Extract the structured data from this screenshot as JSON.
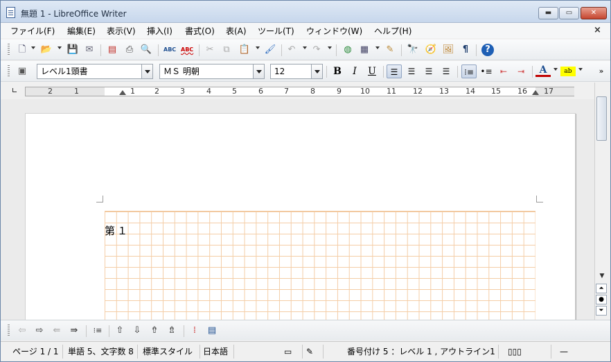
{
  "window": {
    "title": "無題 1 - LibreOffice Writer",
    "min_label": "▬",
    "max_label": "▭",
    "close_label": "✕"
  },
  "menu": {
    "items": [
      "ファイル(F)",
      "編集(E)",
      "表示(V)",
      "挿入(I)",
      "書式(O)",
      "表(A)",
      "ツール(T)",
      "ウィンドウ(W)",
      "ヘルプ(H)"
    ],
    "doc_close": "×"
  },
  "format_bar": {
    "style": "レベル1頭書",
    "font": "ＭＳ 明朝",
    "size": "12",
    "bold": "B",
    "italic": "I",
    "underline": "U"
  },
  "ruler": {
    "numbers": [
      "2",
      "1",
      "1",
      "2",
      "3",
      "4",
      "5",
      "6",
      "7",
      "8",
      "9",
      "10",
      "11",
      "12",
      "13",
      "14",
      "15",
      "16",
      "17"
    ]
  },
  "page": {
    "text": "第１"
  },
  "status": {
    "page": "ページ 1 / 1",
    "words": "単語 5、文字数 8",
    "style": "標準スタイル",
    "language": "日本語",
    "numbering": "番号付け 5 ：レベル 1 , アウトライン1",
    "zoom": "—"
  },
  "icons": {
    "toolbar1": [
      "new-document-icon",
      "open-icon",
      "save-icon",
      "email-icon",
      "export-pdf-icon",
      "print-icon",
      "print-preview-icon",
      "spellcheck-icon",
      "autospell-icon",
      "cut-icon",
      "copy-icon",
      "paste-icon",
      "clone-formatting-icon",
      "undo-icon",
      "redo-icon",
      "navigator-icon",
      "table-icon",
      "draw-icon",
      "find-icon",
      "navigator-compass-icon",
      "gallery-icon",
      "formatting-marks-icon",
      "help-icon"
    ]
  },
  "colors": {
    "accent": "#1e4f91",
    "grid": "#f4cda6",
    "font_color": "#c00000",
    "highlight": "#ffff00"
  }
}
